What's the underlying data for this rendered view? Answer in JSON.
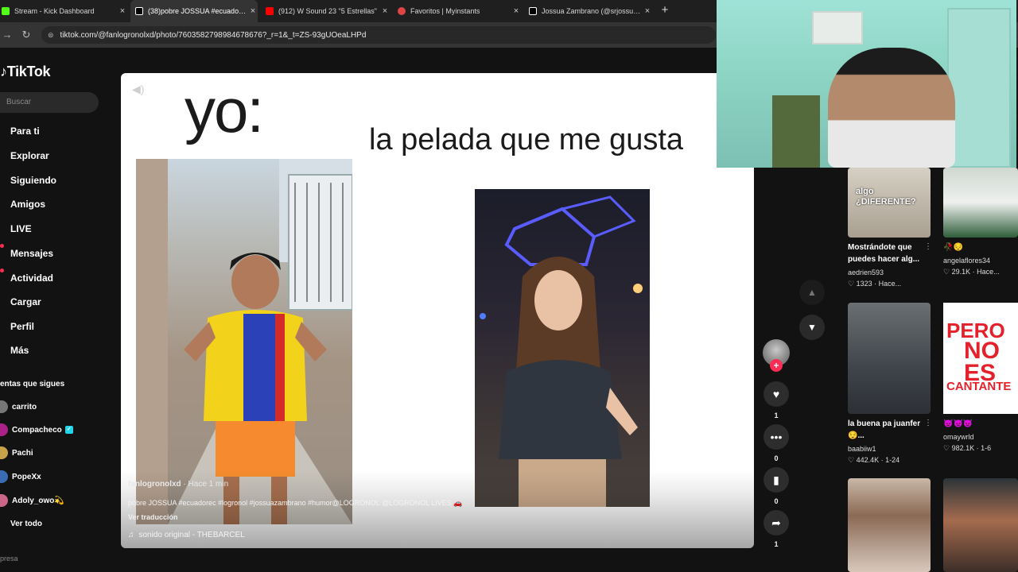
{
  "browser": {
    "tabs": [
      {
        "label": "Stream - Kick Dashboard",
        "color": "#53fc18"
      },
      {
        "label": "(38)pobre JOSSUA #ecuadorec",
        "color": "#ffffff"
      },
      {
        "label": "(912) W Sound 23 \"5 Estrellas\"",
        "color": "#ff0000"
      },
      {
        "label": "Favoritos | Myinstants",
        "color": "#e04545"
      },
      {
        "label": "Jossua Zambrano (@srjossua) |",
        "color": "#ffffff"
      }
    ],
    "new_tab": "+",
    "url": "tiktok.com/@fanlogronolxd/photo/7603582798984678676?_r=1&_t=ZS-93gUOeaLHPd"
  },
  "sidebar": {
    "logo": "TikTok",
    "search_placeholder": "Buscar",
    "nav": [
      "Para ti",
      "Explorar",
      "Siguiendo",
      "Amigos",
      "LIVE",
      "Mensajes",
      "Actividad",
      "Cargar",
      "Perfil",
      "Más"
    ],
    "following_heading": "entas que sigues",
    "accounts": [
      "carrito",
      "Compacheco",
      "Pachi",
      "PopeXx",
      "Adoly_owo💫"
    ],
    "see_all": "Ver todo",
    "footer": "presa"
  },
  "post": {
    "image_text_1": "yo:",
    "image_text_2": "la pelada que me gusta",
    "author": "fanlogronolxd",
    "time": " · Hace 1 min",
    "caption": "pobre JOSSUA #ecuadorec #logronol #jossuazambrano #humor@LOGRONOL @LOGRONOL LIVES 🚗",
    "translate": "Ver traducción",
    "sound": "sonido original - THEBARCEL"
  },
  "actions": {
    "likes": "1",
    "comments": "0",
    "saves": "0",
    "shares": "1"
  },
  "recommendations": [
    {
      "title": "Mostrándote que puedes hacer alg...",
      "user": "aedrien593",
      "stats": "♡ 1323 · Hace...",
      "thumb_text": "algo ¿DIFERENTE?"
    },
    {
      "title": "🥀😔",
      "user": "angelaflores34",
      "stats": "♡ 29.1K · Hace..."
    },
    {
      "title": "la buena pa juanfer😌...",
      "user": "baabiiw1",
      "stats": "♡ 442.4K · 1-24"
    },
    {
      "title": "😈😈😈",
      "user": "omaywrld",
      "stats": "♡ 982.1K · 1-6",
      "thumb_text": [
        "PERO",
        "NO",
        "ES",
        "CANTANTE"
      ]
    }
  ]
}
